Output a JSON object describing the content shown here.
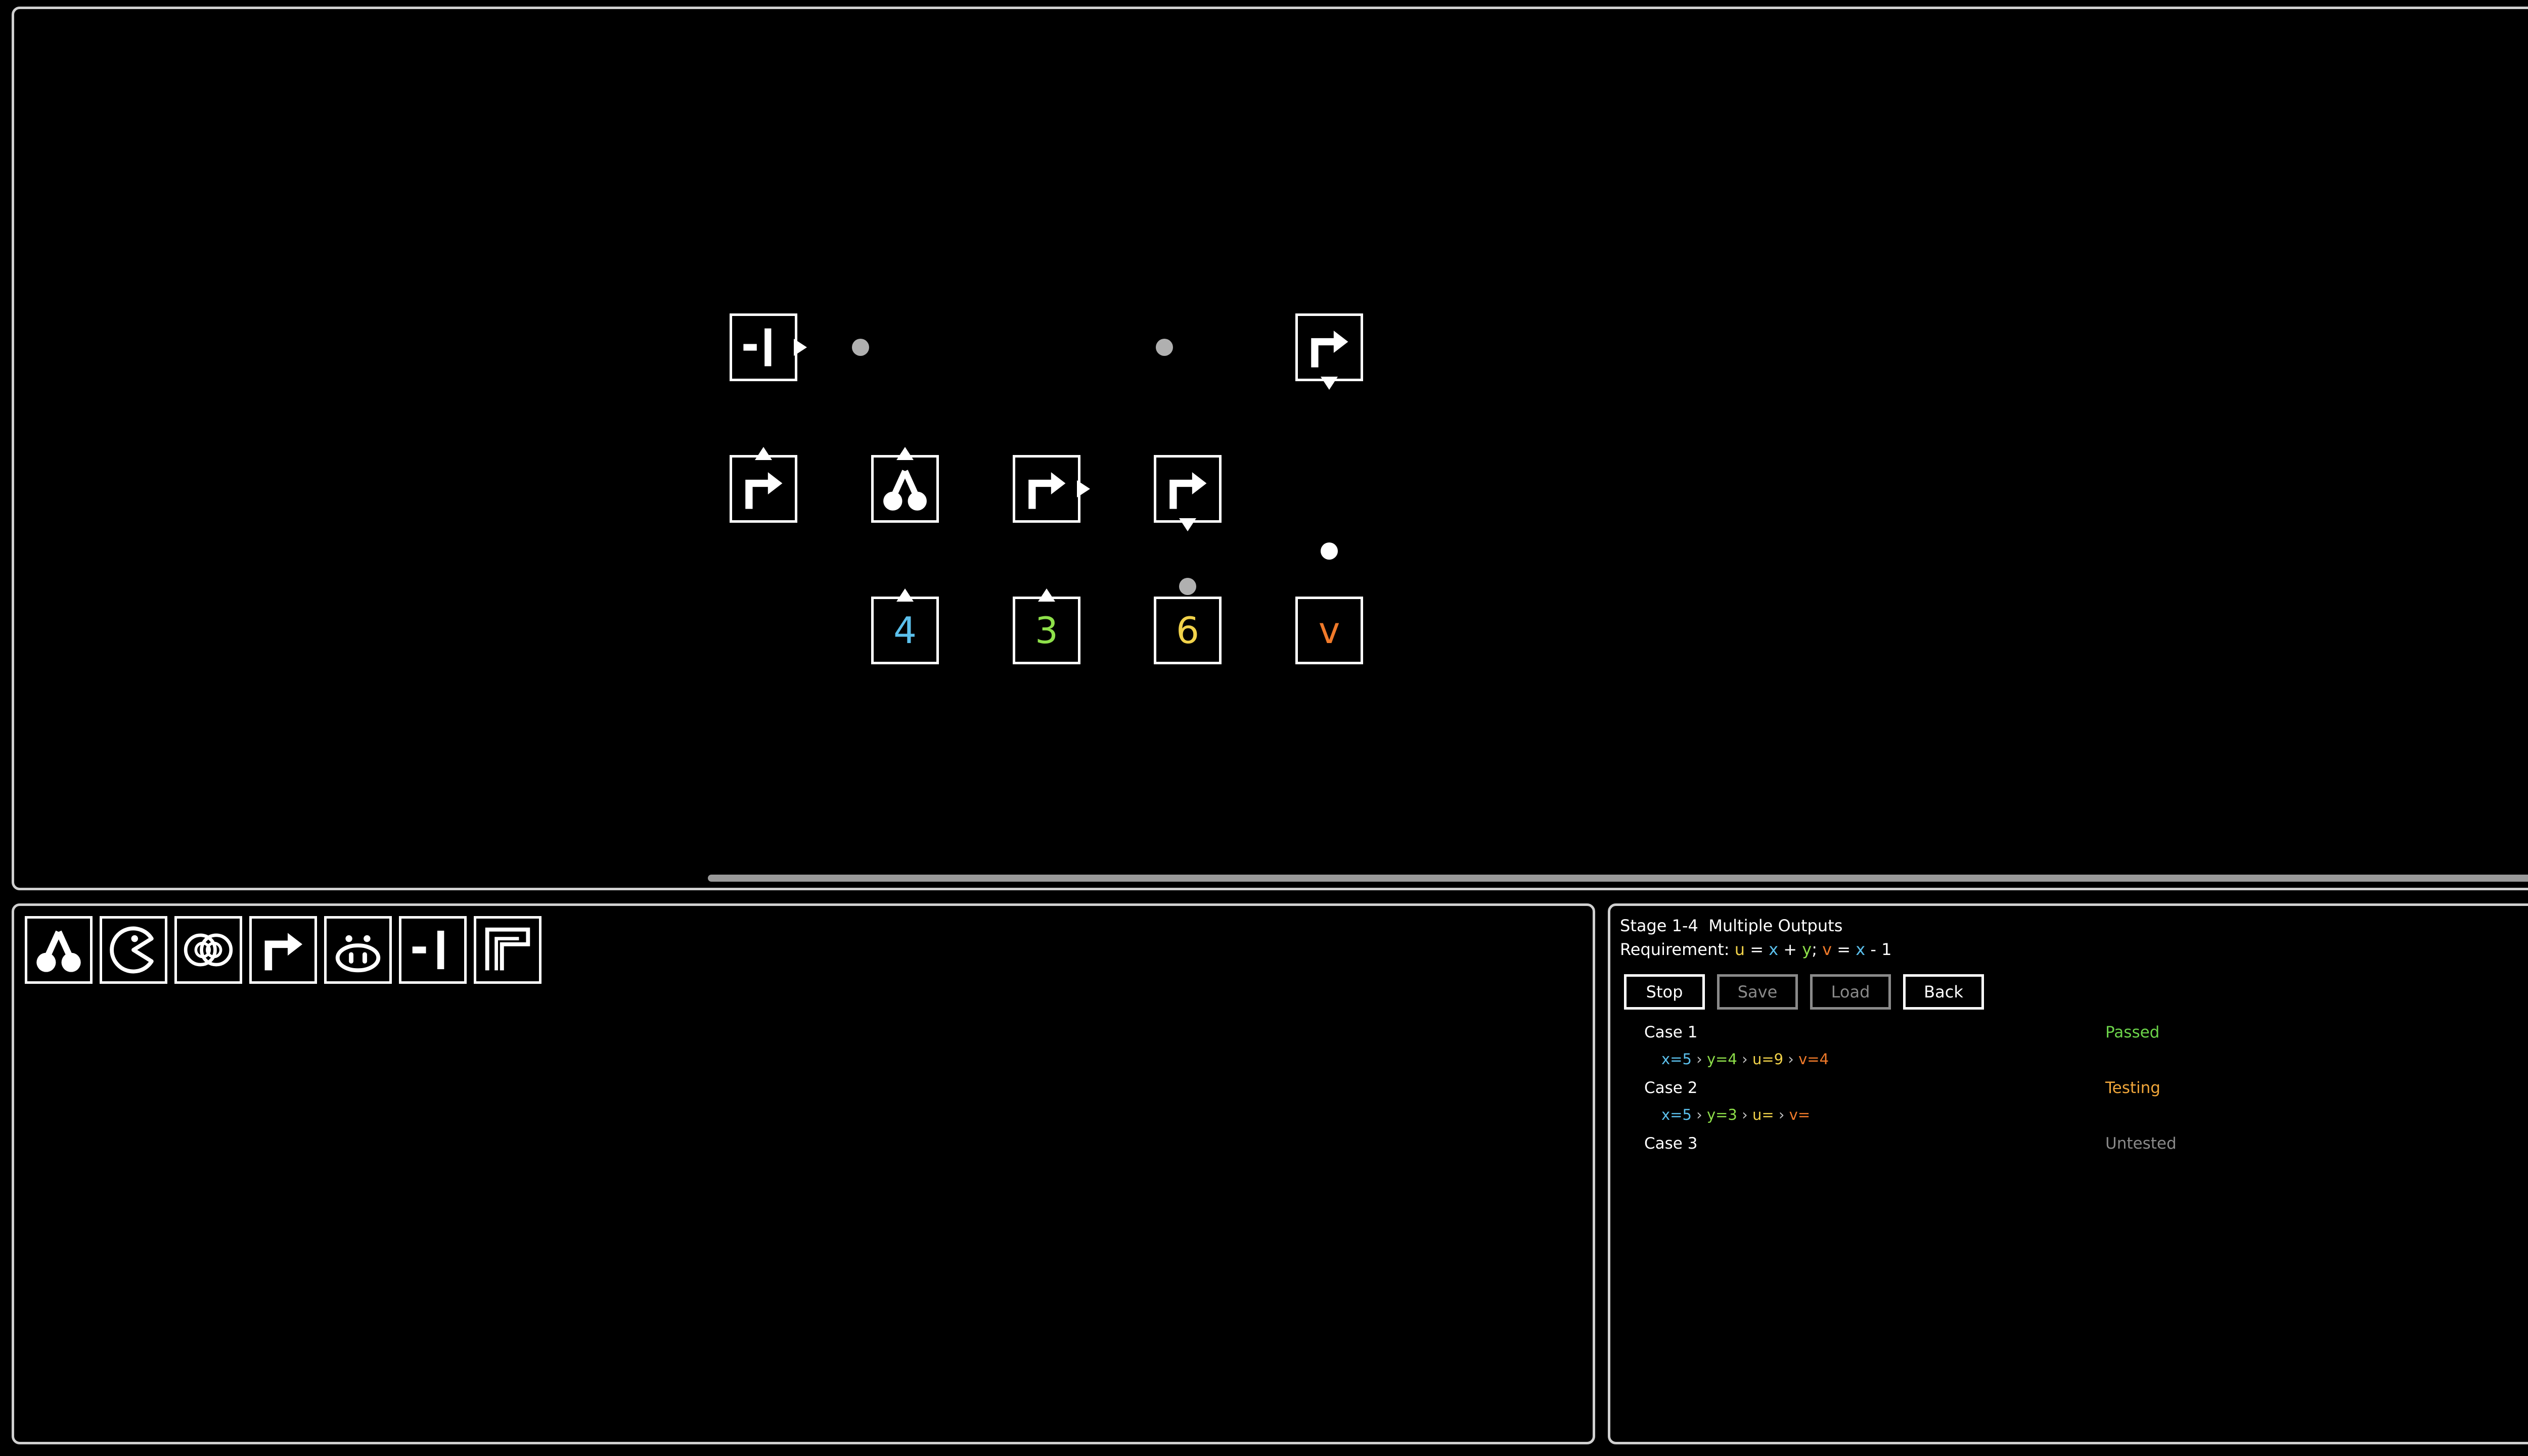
{
  "colors": {
    "x": "#5bc0ec",
    "y": "#8ee04a",
    "u": "#f1d24a",
    "v": "#f07a2a",
    "passed": "#6cd44a",
    "testing": "#f0a63a",
    "untested": "#8a8a8a",
    "dot_gray": "#b0b0b0"
  },
  "board": {
    "tiles": [
      {
        "id": "t1",
        "icon": "minus-bar-icon",
        "arrow": "right"
      },
      {
        "id": "t2",
        "icon": "turn-right-arrow-icon",
        "arrow": "down"
      },
      {
        "id": "t3",
        "icon": "turn-right-arrow-icon",
        "arrow": "up"
      },
      {
        "id": "t4",
        "icon": "fork-icon",
        "arrow": "up"
      },
      {
        "id": "t5",
        "icon": "turn-right-arrow-icon",
        "arrow": "right"
      },
      {
        "id": "t6",
        "icon": "turn-right-arrow-icon",
        "arrow": "down"
      },
      {
        "id": "t7",
        "value": "4",
        "color": "x",
        "arrow": "up"
      },
      {
        "id": "t8",
        "value": "3",
        "color": "y",
        "arrow": "up"
      },
      {
        "id": "t9",
        "value": "6",
        "color": "u"
      },
      {
        "id": "t10",
        "value": "v",
        "color": "v"
      }
    ]
  },
  "toolbox": {
    "tools": [
      "fork-icon",
      "pacman-icon",
      "double-circle-icon",
      "turn-right-arrow-icon",
      "pig-face-icon",
      "minus-bar-icon",
      "corner-frame-icon"
    ]
  },
  "info": {
    "stage": "Stage 1-4",
    "stage_name": "Multiple Outputs",
    "requirement_label": "Requirement:",
    "requirement": {
      "u_var": "u",
      "eq1": "=",
      "x_var": "x",
      "plus": "+",
      "y_var": "y",
      "semi": ";",
      "v_var": "v",
      "eq2": "=",
      "x_var2": "x",
      "minus_one": "- 1"
    },
    "buttons": {
      "stop": "Stop",
      "save": "Save",
      "load": "Load",
      "back": "Back"
    },
    "cases": [
      {
        "label": "Case 1",
        "status": "Passed",
        "x": "x=5",
        "y": "y=4",
        "u": "u=9",
        "v": "v=4"
      },
      {
        "label": "Case 2",
        "status": "Testing",
        "x": "x=5",
        "y": "y=3",
        "u": "u=",
        "v": "v="
      },
      {
        "label": "Case 3",
        "status": "Untested"
      }
    ],
    "separator": "›"
  }
}
